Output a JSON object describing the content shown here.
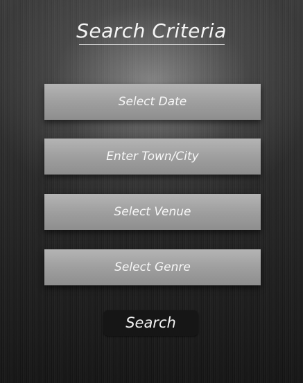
{
  "header": {
    "title": "Search Criteria"
  },
  "form": {
    "fields": [
      {
        "label": "Select Date"
      },
      {
        "label": "Enter Town/City"
      },
      {
        "label": "Select Venue"
      },
      {
        "label": "Select Genre"
      }
    ],
    "search_label": "Search"
  },
  "colors": {
    "background_top": "#3a3a3a",
    "background_bottom": "#141414",
    "field_fill": "#a0a0a0",
    "button_fill": "#161616",
    "text": "#f4f4f4"
  }
}
